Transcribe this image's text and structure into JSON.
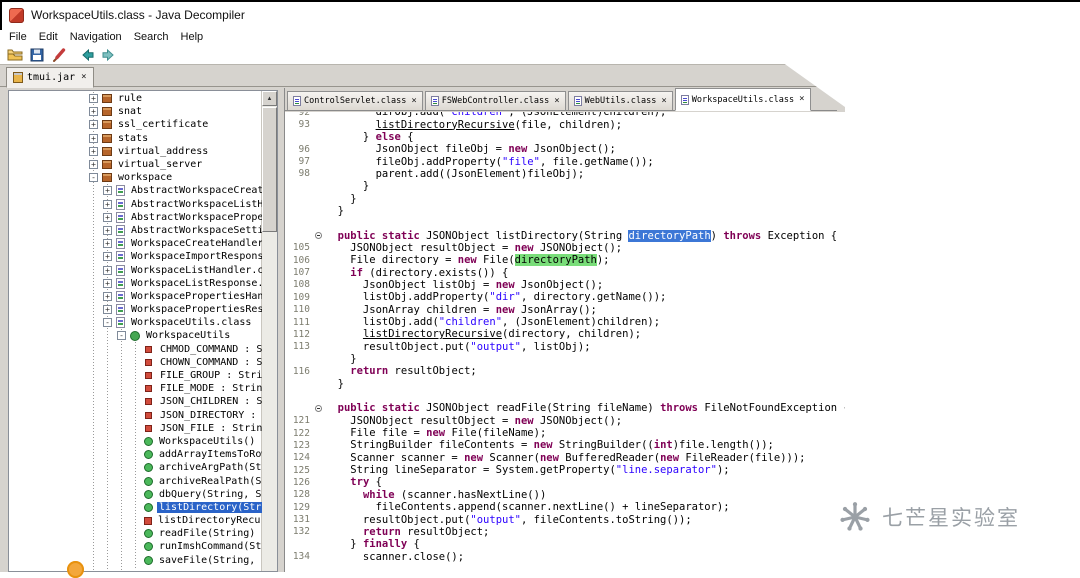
{
  "window": {
    "title": "WorkspaceUtils.class - Java Decompiler",
    "app_icon": "jd-gui-icon"
  },
  "menu": {
    "items": [
      "File",
      "Edit",
      "Navigation",
      "Search",
      "Help"
    ]
  },
  "toolbar": {
    "icons": [
      "open-file-icon",
      "save-all-icon",
      "paintbrush-icon",
      "back-icon",
      "forward-icon"
    ]
  },
  "jar_tab": {
    "label": "tmui.jar",
    "icon": "jar-icon",
    "close_icon": "×"
  },
  "tree": {
    "items": [
      {
        "label": "rule",
        "level": 0,
        "exp": "plus",
        "icon": "package"
      },
      {
        "label": "snat",
        "level": 0,
        "exp": "plus",
        "icon": "package"
      },
      {
        "label": "ssl_certificate",
        "level": 0,
        "exp": "plus",
        "icon": "package"
      },
      {
        "label": "stats",
        "level": 0,
        "exp": "plus",
        "icon": "package"
      },
      {
        "label": "virtual_address",
        "level": 0,
        "exp": "plus",
        "icon": "package"
      },
      {
        "label": "virtual_server",
        "level": 0,
        "exp": "plus",
        "icon": "package"
      },
      {
        "label": "workspace",
        "level": 0,
        "exp": "minus",
        "icon": "package"
      },
      {
        "label": "AbstractWorkspaceCreateHandle",
        "level": 1,
        "exp": "plus",
        "icon": "class"
      },
      {
        "label": "AbstractWorkspaceListHandler.",
        "level": 1,
        "exp": "plus",
        "icon": "class"
      },
      {
        "label": "AbstractWorkspacePropertiesHa",
        "level": 1,
        "exp": "plus",
        "icon": "class"
      },
      {
        "label": "AbstractWorkspaceSettingsHand",
        "level": 1,
        "exp": "plus",
        "icon": "class"
      },
      {
        "label": "WorkspaceCreateHandler.class",
        "level": 1,
        "exp": "plus",
        "icon": "class"
      },
      {
        "label": "WorkspaceImportResponse.class",
        "level": 1,
        "exp": "plus",
        "icon": "class"
      },
      {
        "label": "WorkspaceListHandler.class",
        "level": 1,
        "exp": "plus",
        "icon": "class"
      },
      {
        "label": "WorkspaceListResponse.class",
        "level": 1,
        "exp": "plus",
        "icon": "class"
      },
      {
        "label": "WorkspacePropertiesHandler.cl",
        "level": 1,
        "exp": "plus",
        "icon": "class"
      },
      {
        "label": "WorkspacePropertiesResponse.c",
        "level": 1,
        "exp": "plus",
        "icon": "class"
      },
      {
        "label": "WorkspaceUtils.class",
        "level": 1,
        "exp": "minus",
        "icon": "class"
      },
      {
        "label": "WorkspaceUtils",
        "level": 2,
        "exp": "minus",
        "icon": "type"
      },
      {
        "label": "CHMOD_COMMAND : String",
        "level": 3,
        "exp": "none",
        "icon": "field"
      },
      {
        "label": "CHOWN_COMMAND : String",
        "level": 3,
        "exp": "none",
        "icon": "field"
      },
      {
        "label": "FILE_GROUP : String",
        "level": 3,
        "exp": "none",
        "icon": "field"
      },
      {
        "label": "FILE_MODE : String",
        "level": 3,
        "exp": "none",
        "icon": "field"
      },
      {
        "label": "JSON_CHILDREN : String",
        "level": 3,
        "exp": "none",
        "icon": "field"
      },
      {
        "label": "JSON_DIRECTORY : String",
        "level": 3,
        "exp": "none",
        "icon": "field"
      },
      {
        "label": "JSON_FILE : String",
        "level": 3,
        "exp": "none",
        "icon": "field"
      },
      {
        "label": "WorkspaceUtils()",
        "level": 3,
        "exp": "none",
        "icon": "method"
      },
      {
        "label": "addArrayItemsToRow(Arra",
        "level": 3,
        "exp": "none",
        "icon": "method"
      },
      {
        "label": "archiveArgPath(String,",
        "level": 3,
        "exp": "none",
        "icon": "method"
      },
      {
        "label": "archiveRealPath(String,",
        "level": 3,
        "exp": "none",
        "icon": "method"
      },
      {
        "label": "dbQuery(String, String",
        "level": 3,
        "exp": "none",
        "icon": "method"
      },
      {
        "label": "listDirectory(String)",
        "level": 3,
        "exp": "none",
        "icon": "method",
        "selected": true
      },
      {
        "label": "listDirectoryRecursive(",
        "level": 3,
        "exp": "none",
        "icon": "method_private"
      },
      {
        "label": "readFile(String) : JSON",
        "level": 3,
        "exp": "none",
        "icon": "method"
      },
      {
        "label": "runImshCommand(String)",
        "level": 3,
        "exp": "none",
        "icon": "method"
      },
      {
        "label": "saveFile(String, String",
        "level": 3,
        "exp": "none",
        "icon": "method"
      }
    ]
  },
  "editor": {
    "tabs": [
      {
        "label": "ControlServlet.class"
      },
      {
        "label": "FSWebController.class"
      },
      {
        "label": "WebUtils.class"
      },
      {
        "label": "WorkspaceUtils.class"
      }
    ],
    "active_tab": 3,
    "close_icon": "×",
    "lines": [
      {
        "no": "92",
        "text": "        dirObj.add(\"children\", (JsonElement)children);"
      },
      {
        "no": "93",
        "text": "        listDirectoryRecursive(file, children);"
      },
      {
        "no": "",
        "text": "      } else {"
      },
      {
        "no": "96",
        "text": "        JsonObject fileObj = new JsonObject();"
      },
      {
        "no": "97",
        "text": "        fileObj.addProperty(\"file\", file.getName());"
      },
      {
        "no": "98",
        "text": "        parent.add((JsonElement)fileObj);"
      },
      {
        "no": "",
        "text": "      }"
      },
      {
        "no": "",
        "text": "    }"
      },
      {
        "no": "",
        "text": "  }"
      },
      {
        "no": "",
        "text": ""
      },
      {
        "no": "",
        "text": "  public static JSONObject listDirectory(String directoryPath) throws Exception {",
        "fold": true,
        "hl": {
          "token": "directoryPath",
          "style": "sel"
        }
      },
      {
        "no": "105",
        "text": "    JSONObject resultObject = new JSONObject();"
      },
      {
        "no": "106",
        "text": "    File directory = new File(directoryPath);",
        "hl": {
          "token": "directoryPath",
          "style": "occ"
        }
      },
      {
        "no": "107",
        "text": "    if (directory.exists()) {"
      },
      {
        "no": "108",
        "text": "      JsonObject listObj = new JsonObject();"
      },
      {
        "no": "109",
        "text": "      listObj.addProperty(\"dir\", directory.getName());"
      },
      {
        "no": "110",
        "text": "      JsonArray children = new JsonArray();"
      },
      {
        "no": "111",
        "text": "      listObj.add(\"children\", (JsonElement)children);"
      },
      {
        "no": "112",
        "text": "      listDirectoryRecursive(directory, children);"
      },
      {
        "no": "113",
        "text": "      resultObject.put(\"output\", listObj);"
      },
      {
        "no": "",
        "text": "    }"
      },
      {
        "no": "116",
        "text": "    return resultObject;"
      },
      {
        "no": "",
        "text": "  }"
      },
      {
        "no": "",
        "text": ""
      },
      {
        "no": "",
        "text": "  public static JSONObject readFile(String fileName) throws FileNotFoundException {",
        "fold": true
      },
      {
        "no": "121",
        "text": "    JSONObject resultObject = new JSONObject();"
      },
      {
        "no": "122",
        "text": "    File file = new File(fileName);"
      },
      {
        "no": "123",
        "text": "    StringBuilder fileContents = new StringBuilder((int)file.length());"
      },
      {
        "no": "124",
        "text": "    Scanner scanner = new Scanner(new BufferedReader(new FileReader(file)));"
      },
      {
        "no": "125",
        "text": "    String lineSeparator = System.getProperty(\"line.separator\");"
      },
      {
        "no": "126",
        "text": "    try {"
      },
      {
        "no": "128",
        "text": "      while (scanner.hasNextLine())"
      },
      {
        "no": "129",
        "text": "        fileContents.append(scanner.nextLine() + lineSeparator);"
      },
      {
        "no": "131",
        "text": "      resultObject.put(\"output\", fileContents.toString());"
      },
      {
        "no": "132",
        "text": "      return resultObject;"
      },
      {
        "no": "",
        "text": "    } finally {"
      },
      {
        "no": "134",
        "text": "      scanner.close();"
      }
    ]
  },
  "watermark": {
    "text": "七芒星实验室",
    "icon": "seven-point-star-logo"
  },
  "colors": {
    "chrome_gray": "#d6d3ce",
    "tree_selection_blue": "#2a63c8",
    "code_selection_blue": "#3c77d6",
    "occurrence_green": "#79dd79",
    "keyword_maroon": "#7f0055",
    "string_blue": "#2a00ff"
  }
}
